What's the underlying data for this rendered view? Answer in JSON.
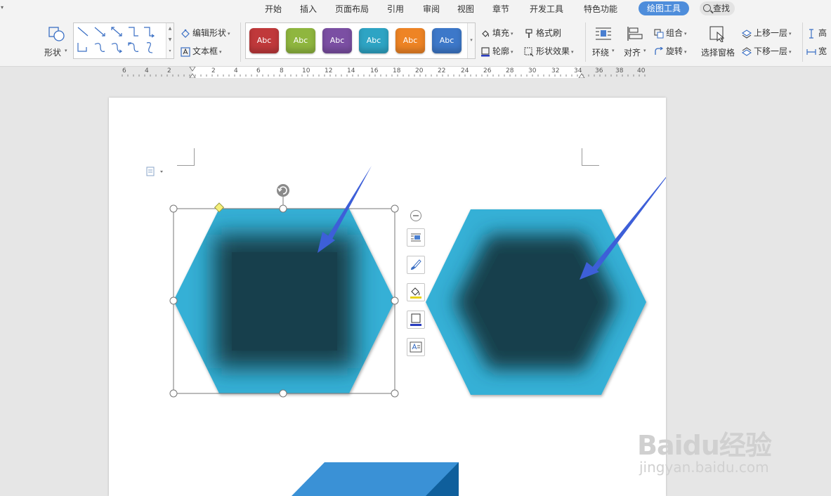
{
  "menu": {
    "tabs": [
      "开始",
      "插入",
      "页面布局",
      "引用",
      "审阅",
      "视图",
      "章节",
      "开发工具",
      "特色功能"
    ],
    "active_tab": "绘图工具",
    "search_label": "查找"
  },
  "ribbon": {
    "shape_label": "形状",
    "edit_shape_label": "编辑形状",
    "textbox_label": "文本框",
    "style_presets": [
      {
        "label": "Abc",
        "color": "#c0393b"
      },
      {
        "label": "Abc",
        "color": "#8fb63f"
      },
      {
        "label": "Abc",
        "color": "#7b4fa3"
      },
      {
        "label": "Abc",
        "color": "#2ea4c4"
      },
      {
        "label": "Abc",
        "color": "#ee8425"
      },
      {
        "label": "Abc",
        "color": "#3d78c9"
      }
    ],
    "fill_label": "填充",
    "format_painter_label": "格式刷",
    "outline_label": "轮廓",
    "shape_effects_label": "形状效果",
    "wrap_label": "环绕",
    "align_label": "对齐",
    "group_label": "组合",
    "rotate_label": "旋转",
    "selection_pane_label": "选择窗格",
    "bring_forward_label": "上移一层",
    "send_backward_label": "下移一层",
    "height_label": "高",
    "width_label": "宽"
  },
  "ruler": {
    "labels": [
      "6",
      "4",
      "2",
      "2",
      "4",
      "6",
      "8",
      "10",
      "12",
      "14",
      "16",
      "18",
      "20",
      "22",
      "24",
      "26",
      "28",
      "30",
      "32",
      "34",
      "36",
      "38",
      "40"
    ]
  },
  "canvas": {
    "hex_color": "#36b0d6",
    "hex_shadow_color": "#173f4c",
    "arrow_color": "#3d5fd8",
    "bottom_shape_color": "#3a91d6",
    "bottom_shape_side_color": "#0f5f9c"
  },
  "watermark": {
    "brand": "Baidu经验",
    "url": "jingyan.baidu.com"
  }
}
